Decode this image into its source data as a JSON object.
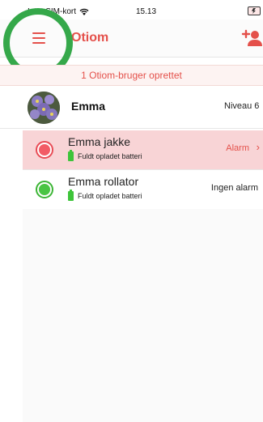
{
  "status_bar": {
    "carrier": "Intet SIM-kort",
    "time": "15.13"
  },
  "nav": {
    "title": "Otiom"
  },
  "banner": {
    "text": "1 Otiom-bruger oprettet"
  },
  "user": {
    "name": "Emma",
    "level": "Niveau 6"
  },
  "devices": [
    {
      "name": "Emma jakke",
      "battery": "Fuldt opladet batteri",
      "status": "Alarm",
      "status_color": "#e4504a"
    },
    {
      "name": "Emma rollator",
      "battery": "Fuldt opladet batteri",
      "status": "Ingen alarm",
      "status_color": "#3cb535"
    }
  ],
  "colors": {
    "accent": "#e4504a",
    "highlight_ring": "#35a84a",
    "alarm_row_bg": "#f8d4d6"
  },
  "icons": {
    "menu": "hamburger-menu-icon",
    "add_user": "add-user-icon",
    "wifi": "wifi-icon",
    "battery": "battery-charging-icon",
    "device_battery": "battery-full-icon"
  }
}
